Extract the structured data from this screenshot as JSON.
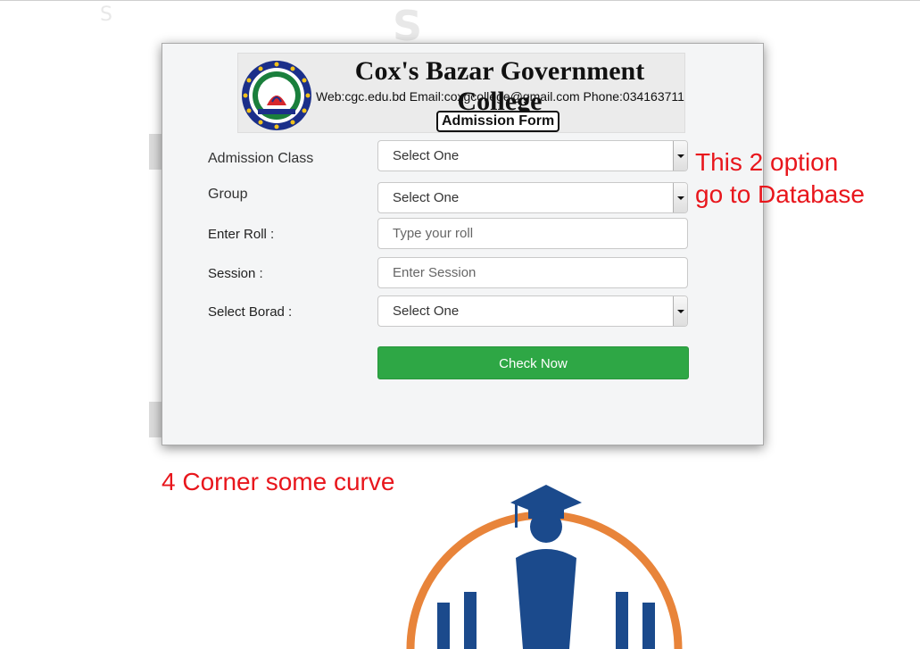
{
  "header": {
    "college_name": "Cox's Bazar Government College",
    "contact_line": "Web:cgc.edu.bd Email:coxgcollege@gmail.com Phone:034163711",
    "form_title": "Admission Form"
  },
  "form": {
    "admission_class_label": "Admission Class",
    "admission_class_value": "Select One",
    "group_label": "Group",
    "group_value": "Select One",
    "roll_label": "Enter Roll :",
    "roll_placeholder": "Type your roll",
    "session_label": "Session :",
    "session_placeholder": "Enter Session",
    "board_label": "Select Borad :",
    "board_value": "Select One",
    "submit_label": "Check Now"
  },
  "annotations": {
    "db_note_line1": "This 2 option",
    "db_note_line2": "go to Database",
    "corner_note": "4 Corner some curve"
  },
  "colors": {
    "button": "#2ea745",
    "annotation": "#e8161c",
    "graphic_arc": "#e8843a",
    "graphic_figure": "#1b4a8c"
  }
}
